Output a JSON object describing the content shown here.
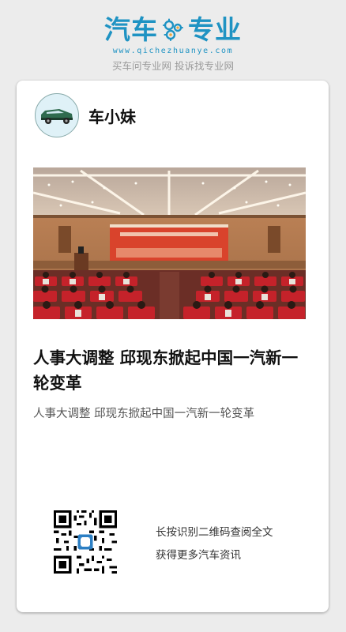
{
  "brand": {
    "word_left": "汽车",
    "word_right": "专业",
    "url": "www.qichezhuanye.com",
    "tagline": "买车问专业网 投诉找专业网",
    "colors": {
      "primary": "#1f93c3",
      "accent": "#f0a63a"
    }
  },
  "author": {
    "name": "车小妹",
    "avatar_icon": "green-car-icon"
  },
  "article": {
    "title": "人事大调整  邱现东掀起中国一汽新一轮变革",
    "summary": "人事大调整  邱现东掀起中国一汽新一轮变革",
    "image": "conference-hall-photo"
  },
  "footer": {
    "line1": "长按识别二维码查阅全文",
    "line2": "获得更多汽车资讯",
    "qr_icon": "qr-code-icon"
  }
}
